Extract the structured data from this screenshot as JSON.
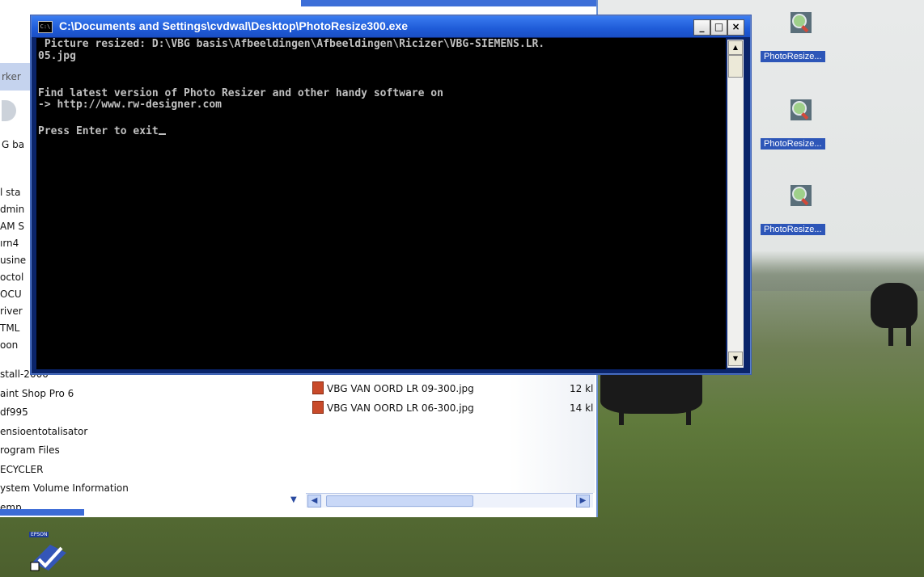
{
  "console": {
    "title": "C:\\Documents and Settings\\cvdwal\\Desktop\\PhotoResize300.exe",
    "icon": "console-icon",
    "minimize": "_",
    "maximize": "□",
    "close": "×",
    "lines": [
      " Picture resized: D:\\VBG basis\\Afbeeldingen\\Afbeeldingen\\Ricizer\\VBG-SIEMENS.LR.",
      "05.jpg",
      "",
      "Find latest version of Photo Resizer and other handy software on",
      "-> http://www.rw-designer.com",
      "",
      "Press Enter to exit"
    ]
  },
  "explorer": {
    "fragments": [
      "rker",
      "G ba"
    ],
    "tree_top": [
      "l sta",
      "dmin",
      "AM S",
      "ırn4",
      "usine",
      "octol",
      "OCU",
      "river",
      "TML",
      "oon"
    ],
    "tree_bottom": [
      "stall-2000",
      "aint Shop Pro 6",
      "df995",
      "ensioentotalisator",
      "rogram Files",
      "ECYCLER",
      "ystem Volume Information",
      "emp"
    ],
    "files": [
      {
        "name": "VBG VAN OORD LR 09-300.jpg",
        "size": "12 kl"
      },
      {
        "name": "VBG VAN OORD LR 06-300.jpg",
        "size": "14 kl"
      }
    ]
  },
  "desktop": {
    "icons": [
      {
        "label": "PhotoResize...",
        "icon": "photoresize-icon"
      },
      {
        "label": "PhotoResize...",
        "icon": "photoresize-icon"
      },
      {
        "label": "PhotoResize...",
        "icon": "photoresize-icon"
      }
    ],
    "epson_tag": "EPSON"
  }
}
